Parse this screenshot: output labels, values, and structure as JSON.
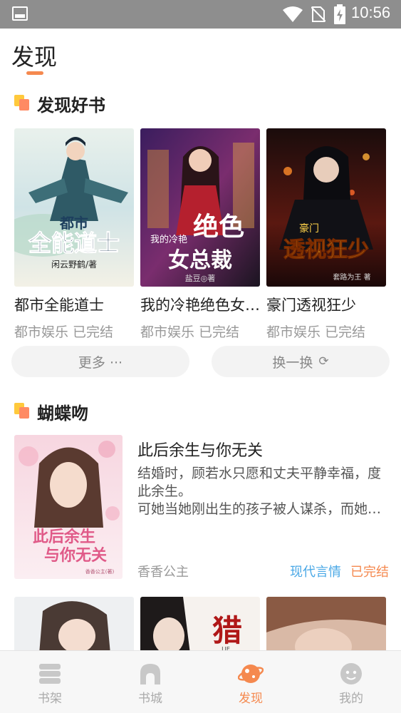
{
  "status_bar": {
    "time": "10:56"
  },
  "page": {
    "title": "发现"
  },
  "section_discover": {
    "title": "发现好书",
    "books": [
      {
        "title": "都市全能道士",
        "meta": "都市娱乐 已完结"
      },
      {
        "title": "我的冷艳绝色女总裁",
        "meta": "都市娱乐 已完结"
      },
      {
        "title": "豪门透视狂少",
        "meta": "都市娱乐 已完结"
      }
    ],
    "more_label": "更多 ···",
    "refresh_label": "换一换"
  },
  "section_butterfly": {
    "title": "蝴蝶吻",
    "featured": {
      "title": "此后余生与你无关",
      "desc_line1": "结婚时，顾若水只愿和丈夫平静幸福，度此余生。",
      "desc_line2": "可她当她刚出生的孩子被人谋杀，而她为了查清真相",
      "author": "香香公主",
      "genre": "现代言情",
      "status": "已完结"
    }
  },
  "covers": {
    "c1": {
      "big": "全能道士",
      "top": "都市",
      "author": "闲云野鹤/著"
    },
    "c2": {
      "top": "我的冷艳",
      "big": "绝色",
      "big2": "女总裁",
      "author": "盐豆◎著"
    },
    "c3": {
      "top": "豪门",
      "big": "透视狂少",
      "author": "套路为王 著"
    },
    "c4": {
      "big": "此后余生",
      "big2": "与你无关",
      "author": "香香公主(著)"
    },
    "r2": {
      "big": "猎",
      "small": "LIE"
    }
  },
  "bottom_nav": [
    {
      "label": "书架",
      "icon": "bookshelf-icon"
    },
    {
      "label": "书城",
      "icon": "bookstore-icon"
    },
    {
      "label": "发现",
      "icon": "discover-icon",
      "active": true
    },
    {
      "label": "我的",
      "icon": "profile-icon"
    }
  ],
  "colors": {
    "accent": "#f5894f",
    "tag_blue": "#4aa8e6",
    "status_bar": "#8e8e8e"
  }
}
